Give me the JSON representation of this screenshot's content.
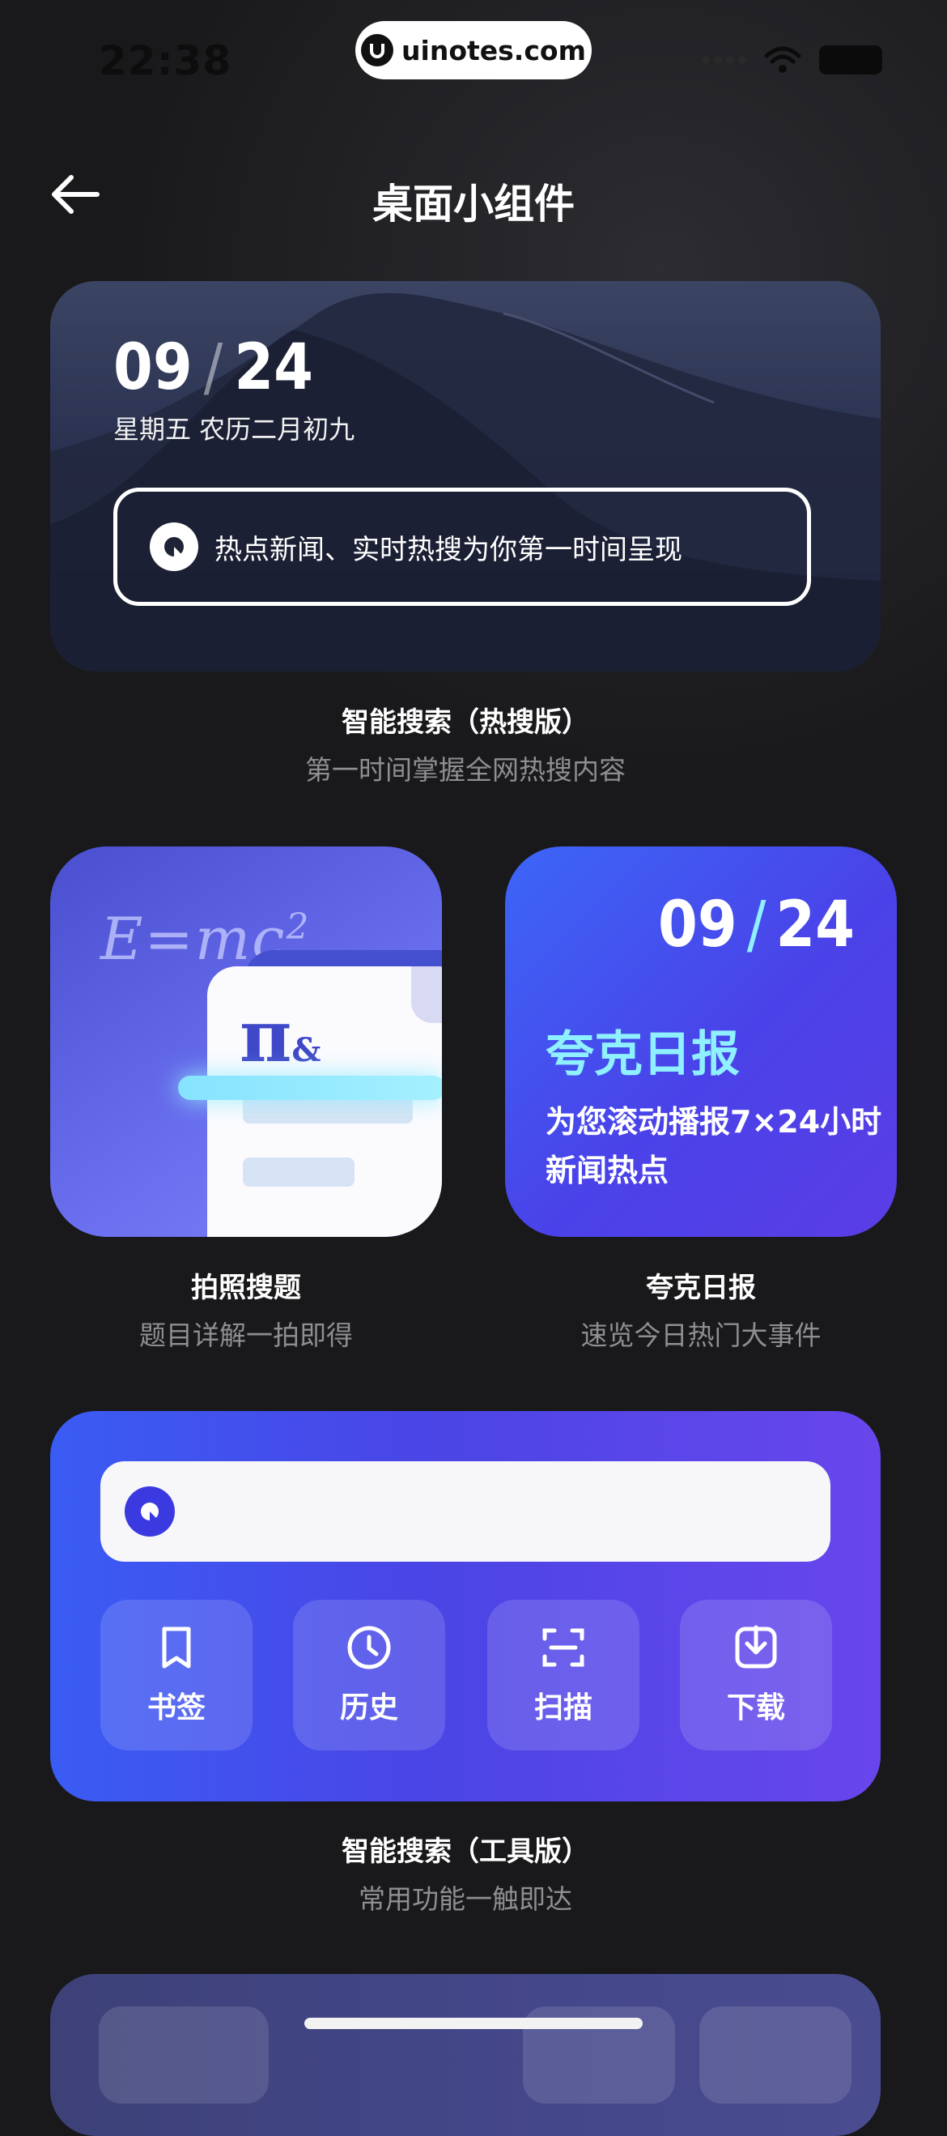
{
  "status_bar": {
    "time": "22:38",
    "url": "uinotes.com"
  },
  "header": {
    "title": "桌面小组件"
  },
  "widget_hot": {
    "month": "09",
    "day": "24",
    "lunar": "星期五  农历二月初九",
    "search_text": "热点新闻、实时热搜为你第一时间呈现",
    "title": "智能搜索（热搜版）",
    "subtitle": "第一时间掌握全网热搜内容"
  },
  "widget_photo": {
    "formula": "E=mc",
    "formula_exp": "2",
    "pi": "π",
    "amp": "&",
    "title": "拍照搜题",
    "subtitle": "题目详解一拍即得"
  },
  "widget_daily": {
    "month": "09",
    "day": "24",
    "name": "夸克日报",
    "desc": "为您滚动播报7×24小时新闻热点",
    "title": "夸克日报",
    "subtitle": "速览今日热门大事件"
  },
  "widget_tools": {
    "buttons": [
      {
        "label": "书签",
        "icon": "bookmark-icon"
      },
      {
        "label": "历史",
        "icon": "clock-icon"
      },
      {
        "label": "扫描",
        "icon": "scan-icon"
      },
      {
        "label": "下载",
        "icon": "download-icon"
      }
    ],
    "title": "智能搜索（工具版）",
    "subtitle": "常用功能一触即达"
  },
  "colors": {
    "background": "#19191b",
    "accent_cyan": "#8ff0ff",
    "brand_blue": "#4a45e6"
  }
}
